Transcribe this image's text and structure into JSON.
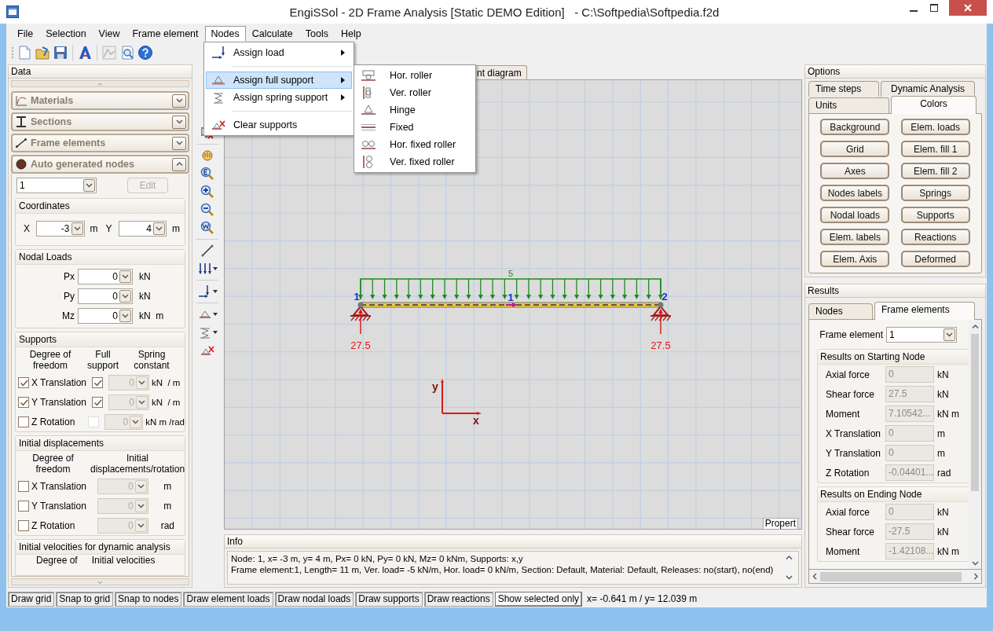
{
  "window": {
    "title": "EngiSSol - 2D Frame Analysis [Static DEMO Edition]   - C:\\Softpedia\\Softpedia.f2d"
  },
  "menu": [
    {
      "label": "File",
      "selected": false
    },
    {
      "label": "Selection",
      "selected": false
    },
    {
      "label": "View",
      "selected": false
    },
    {
      "label": "Frame element",
      "selected": false
    },
    {
      "label": "Nodes",
      "selected": true
    },
    {
      "label": "Calculate",
      "selected": false
    },
    {
      "label": "Tools",
      "selected": false
    },
    {
      "label": "Help",
      "selected": false
    }
  ],
  "nodes_menu": [
    {
      "label": "Assign load",
      "kind": "load",
      "submenu": true,
      "selected": false
    },
    {
      "label": "Assign full support",
      "kind": "support",
      "submenu": true,
      "selected": true
    },
    {
      "label": "Assign spring support",
      "kind": "spring",
      "submenu": true,
      "selected": false
    },
    {
      "label": "Clear supports",
      "kind": "clear",
      "submenu": false,
      "selected": false
    }
  ],
  "support_submenu": [
    {
      "label": "Hor. roller",
      "kind": "hroller"
    },
    {
      "label": "Ver. roller",
      "kind": "vroller"
    },
    {
      "label": "Hinge",
      "kind": "hinge"
    },
    {
      "label": "Fixed",
      "kind": "fixed"
    },
    {
      "label": "Hor. fixed roller",
      "kind": "hfixed"
    },
    {
      "label": "Ver. fixed roller",
      "kind": "vfixed"
    }
  ],
  "data_panel": {
    "title": "Data",
    "sections": [
      {
        "label": "Materials",
        "kind": "materials",
        "expanded": false
      },
      {
        "label": "Sections",
        "kind": "sections",
        "expanded": false
      },
      {
        "label": "Frame elements",
        "kind": "elements",
        "expanded": false
      },
      {
        "label": "Auto generated nodes",
        "kind": "nodes",
        "expanded": true
      }
    ],
    "node_select": "1",
    "edit_button": {
      "label": "Edit",
      "disabled": true
    },
    "coordinates": {
      "title": "Coordinates",
      "fields": [
        {
          "label": "X",
          "value": "-3",
          "unit": "m"
        },
        {
          "label": "Y",
          "value": "4",
          "unit": "m"
        }
      ]
    },
    "nodal_loads": {
      "title": "Nodal Loads",
      "rows": [
        {
          "label": "Px",
          "value": "0",
          "unit": "kN"
        },
        {
          "label": "Py",
          "value": "0",
          "unit": "kN"
        },
        {
          "label": "Mz",
          "value": "0",
          "unit": "kN  m"
        }
      ]
    },
    "supports": {
      "title": "Supports",
      "headers": [
        "Degree of\nfreedom",
        "Full\nsupport",
        "Spring\nconstant"
      ],
      "rows": [
        {
          "label": "X Translation",
          "checked": true,
          "full_support": true,
          "full_support_disabled": false,
          "value": "0",
          "unit": "kN  / m",
          "spring_disabled": true
        },
        {
          "label": "Y Translation",
          "checked": true,
          "full_support": true,
          "full_support_disabled": false,
          "value": "0",
          "unit": "kN  / m",
          "spring_disabled": true
        },
        {
          "label": "Z Rotation",
          "checked": false,
          "full_support": false,
          "full_support_disabled": true,
          "value": "0",
          "unit": "kN m /rad",
          "spring_disabled": true
        }
      ]
    },
    "initial_displacements": {
      "title": "Initial displacements",
      "headers": [
        "Degree of\nfreedom",
        "Initial\ndisplacements/rotation"
      ],
      "rows": [
        {
          "label": "X Translation",
          "checked": false,
          "value": "0",
          "unit": "m",
          "disabled": true
        },
        {
          "label": "Y Translation",
          "checked": false,
          "value": "0",
          "unit": "m",
          "disabled": true
        },
        {
          "label": "Z Rotation",
          "checked": false,
          "value": "0",
          "unit": "rad",
          "disabled": true
        }
      ]
    },
    "initial_velocities": {
      "title": "Initial velocities for dynamic analysis",
      "headers": [
        "Degree of",
        "Initial velocities"
      ]
    }
  },
  "canvas": {
    "tab": "nt diagram",
    "load_label": "5",
    "node_labels": [
      "1",
      "2"
    ],
    "element_label": "1",
    "reactions": [
      "27.5",
      "27.5"
    ],
    "axis_labels": [
      "x",
      "y"
    ],
    "corner_tab": "Propert"
  },
  "info": {
    "title": "Info",
    "lines": [
      "Node: 1, x= -3 m, y= 4 m, Px= 0 kN, Py= 0 kN, Mz= 0 kNm, Supports: x,y",
      "Frame element:1, Length= 11 m, Ver. load= -5 kN/m, Hor. load= 0 kN/m, Section: Default, Material: Default, Releases: no(start), no(end)"
    ]
  },
  "options": {
    "title": "Options",
    "tabs": [
      {
        "label": "Time steps",
        "selected": false
      },
      {
        "label": "Dynamic Analysis",
        "selected": false
      },
      {
        "label": "Units",
        "selected": false
      },
      {
        "label": "Colors",
        "selected": true
      }
    ],
    "buttons": [
      "Background",
      "Elem. loads",
      "Grid",
      "Elem. fill 1",
      "Axes",
      "Elem. fill 2",
      "Nodes labels",
      "Springs",
      "Nodal loads",
      "Supports",
      "Elem. labels",
      "Reactions",
      "Elem. Axis",
      "Deformed"
    ]
  },
  "results": {
    "title": "Results",
    "tabs": [
      {
        "label": "Nodes",
        "selected": false
      },
      {
        "label": "Frame elements",
        "selected": true
      }
    ],
    "frame_element": {
      "label": "Frame element",
      "value": "1"
    },
    "groups": [
      {
        "title": "Results on Starting Node",
        "rows": [
          {
            "label": "Axial force",
            "value": "0",
            "unit": "kN"
          },
          {
            "label": "Shear force",
            "value": "27.5",
            "unit": "kN"
          },
          {
            "label": "Moment",
            "value": "7.10542...",
            "unit": "kN m"
          },
          {
            "label": "X Translation",
            "value": "0",
            "unit": "m"
          },
          {
            "label": "Y Translation",
            "value": "0",
            "unit": "m"
          },
          {
            "label": "Z Rotation",
            "value": "-0.04401...",
            "unit": "rad"
          }
        ]
      },
      {
        "title": "Results on Ending Node",
        "rows": [
          {
            "label": "Axial force",
            "value": "0",
            "unit": "kN"
          },
          {
            "label": "Shear force",
            "value": "-27.5",
            "unit": "kN"
          },
          {
            "label": "Moment",
            "value": "-1.42108...",
            "unit": "kN m"
          }
        ]
      }
    ]
  },
  "status_bar": {
    "toggles": [
      {
        "label": "Draw grid",
        "on": true
      },
      {
        "label": "Snap to grid",
        "on": true
      },
      {
        "label": "Snap to nodes",
        "on": true
      },
      {
        "label": "Draw element loads",
        "on": true
      },
      {
        "label": "Draw nodal loads",
        "on": true
      },
      {
        "label": "Draw supports",
        "on": true
      },
      {
        "label": "Draw reactions",
        "on": true
      },
      {
        "label": "Show selected only",
        "on": false
      }
    ],
    "coordinates": "x= -0.641 m / y= 12.039 m"
  }
}
